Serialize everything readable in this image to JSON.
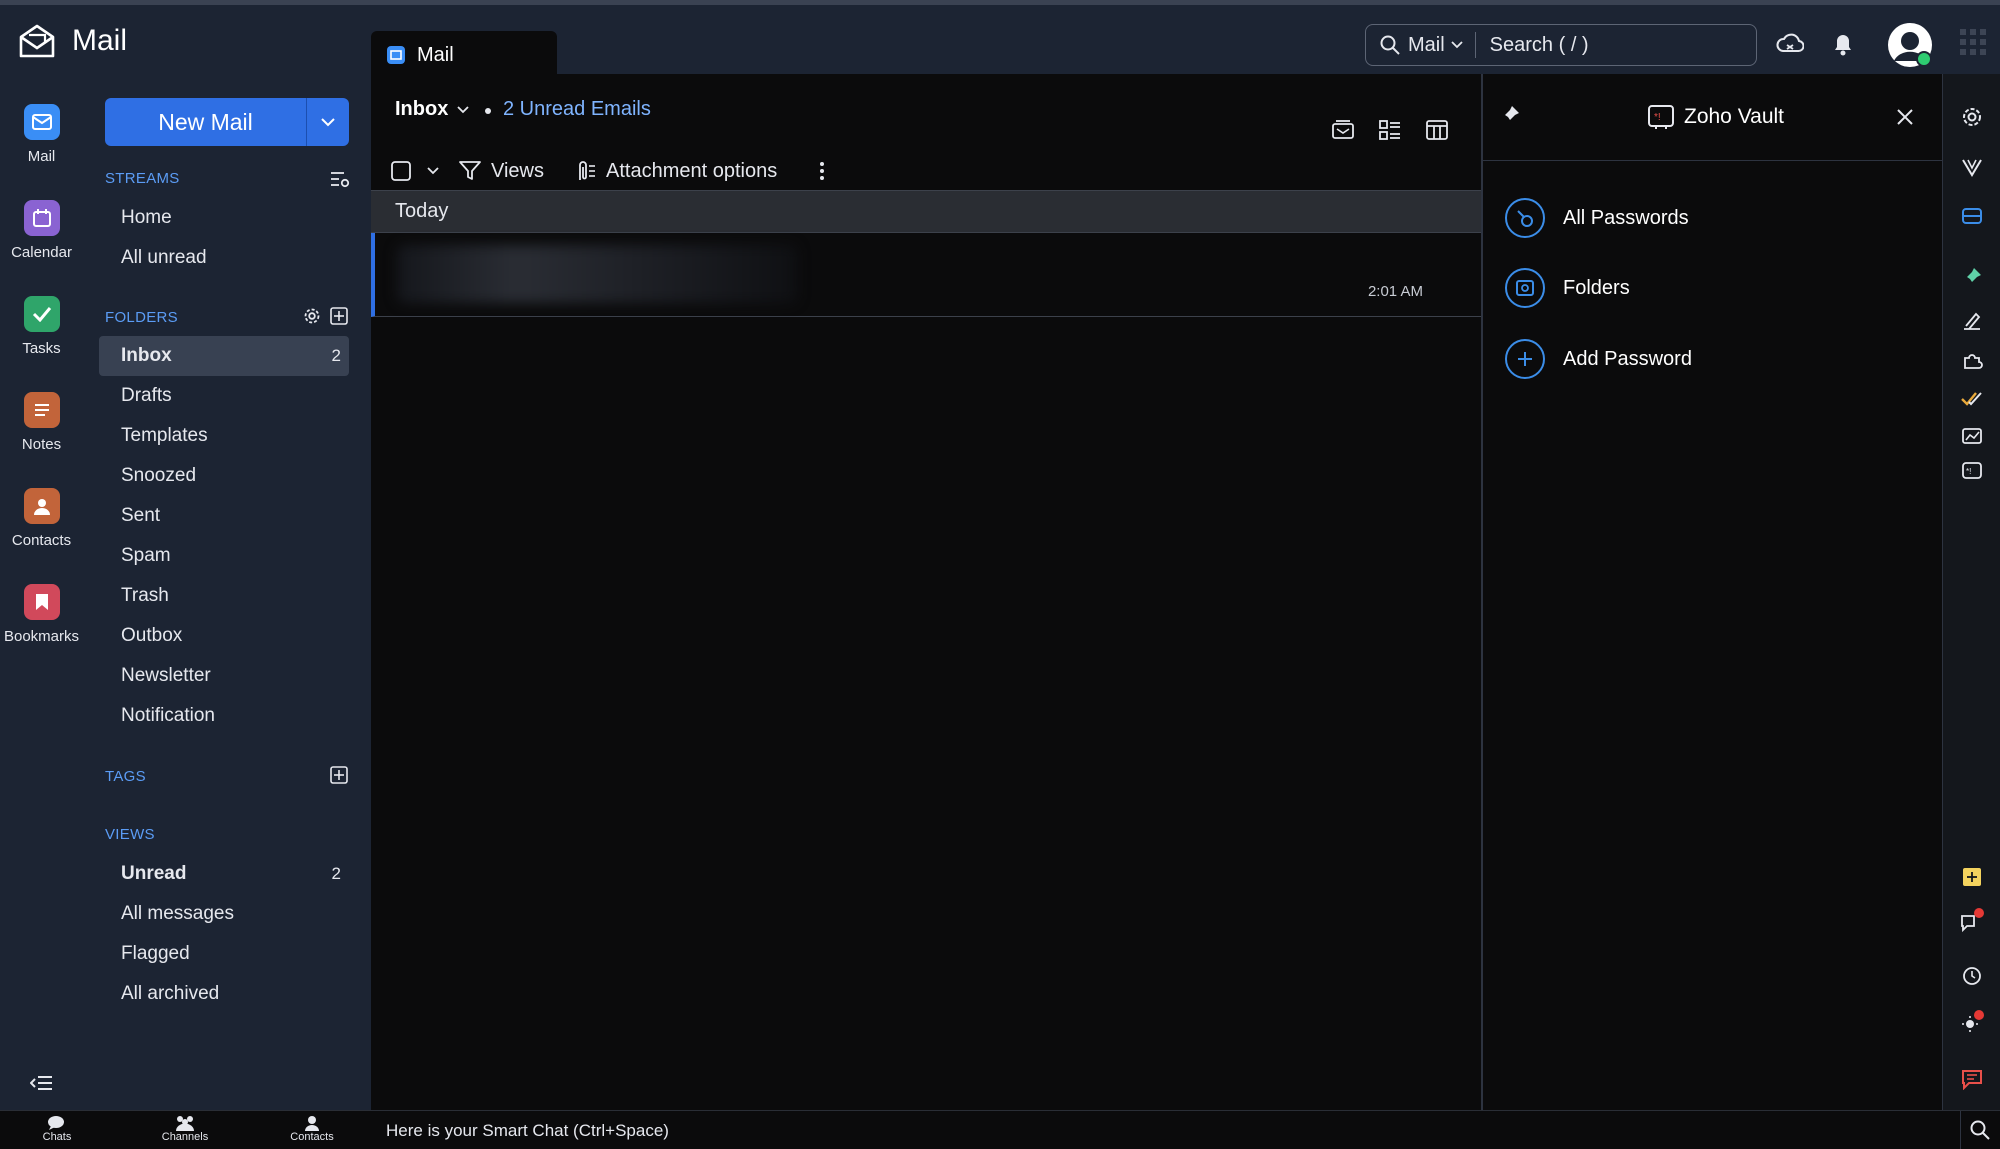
{
  "app": {
    "title": "Mail"
  },
  "tab": {
    "label": "Mail"
  },
  "search": {
    "scope": "Mail",
    "placeholder": "Search ( / )"
  },
  "rail": [
    {
      "label": "Mail"
    },
    {
      "label": "Calendar"
    },
    {
      "label": "Tasks"
    },
    {
      "label": "Notes"
    },
    {
      "label": "Contacts"
    },
    {
      "label": "Bookmarks"
    }
  ],
  "folderpane": {
    "new_mail": "New Mail",
    "streams_heading": "STREAMS",
    "streams": [
      "Home",
      "All unread"
    ],
    "folders_heading": "FOLDERS",
    "folders": [
      {
        "label": "Inbox",
        "count": "2"
      },
      {
        "label": "Drafts"
      },
      {
        "label": "Templates"
      },
      {
        "label": "Snoozed"
      },
      {
        "label": "Sent"
      },
      {
        "label": "Spam"
      },
      {
        "label": "Trash"
      },
      {
        "label": "Outbox"
      },
      {
        "label": "Newsletter"
      },
      {
        "label": "Notification"
      }
    ],
    "tags_heading": "TAGS",
    "views_heading": "VIEWS",
    "views": [
      {
        "label": "Unread",
        "count": "2"
      },
      {
        "label": "All messages"
      },
      {
        "label": "Flagged"
      },
      {
        "label": "All archived"
      }
    ]
  },
  "list": {
    "title": "Inbox",
    "unread": "2 Unread Emails",
    "views": "Views",
    "attachment_options": "Attachment options",
    "group": "Today",
    "mail_time": "2:01 AM"
  },
  "vault": {
    "title": "Zoho Vault",
    "items": [
      "All Passwords",
      "Folders",
      "Add Password"
    ]
  },
  "bottom": {
    "chats": "Chats",
    "channels": "Channels",
    "contacts": "Contacts",
    "smart_chat": "Here is your Smart Chat (Ctrl+Space)"
  },
  "colors": {
    "accent": "#2f6fe4",
    "link": "#7fb4ff",
    "section": "#5b9cf5"
  }
}
